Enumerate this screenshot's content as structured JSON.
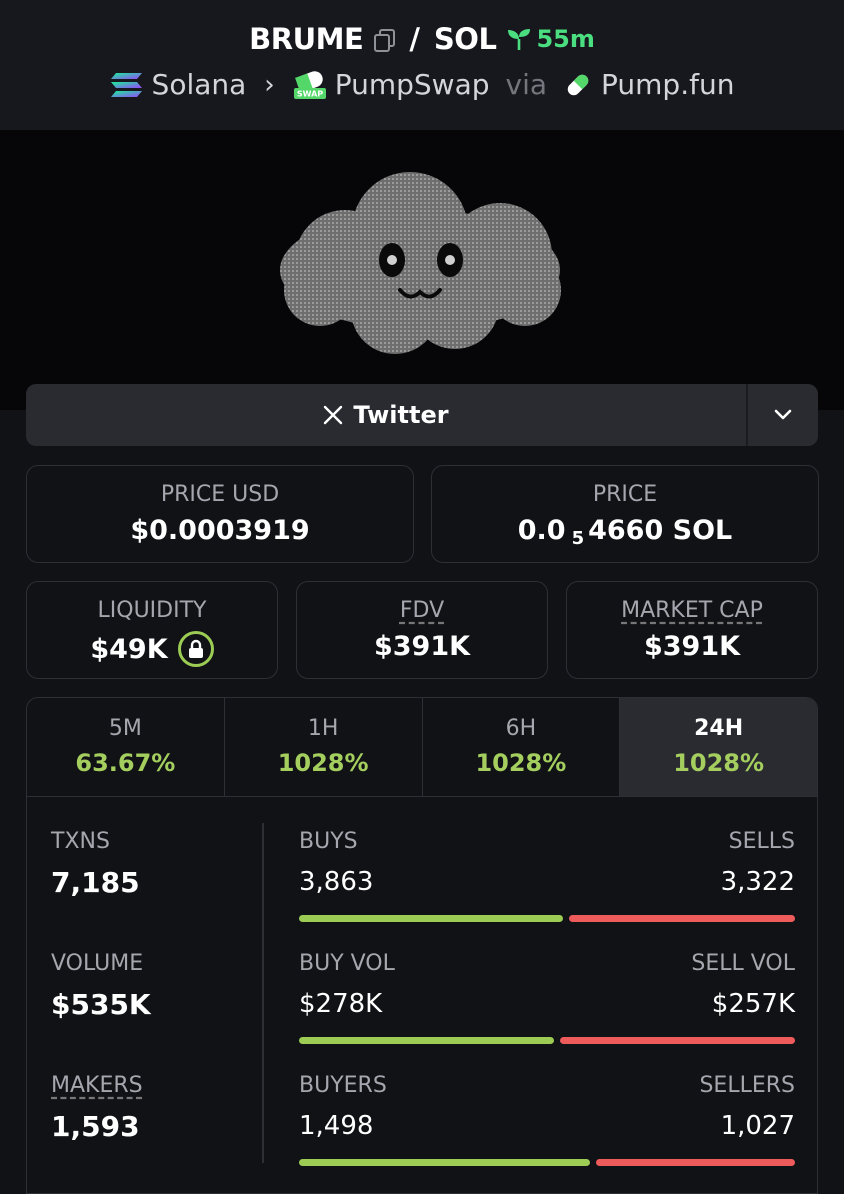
{
  "header": {
    "token": "BRUME",
    "separator": "/",
    "quote": "SOL",
    "age": "55m",
    "chain": "Solana",
    "dex": "PumpSwap",
    "via": "via",
    "launchpad": "Pump.fun",
    "dex_icon_text": "SWAP"
  },
  "socials": {
    "twitter_label": "Twitter"
  },
  "price": {
    "usd_label": "PRICE USD",
    "usd_value": "$0.0003919",
    "native_label": "PRICE",
    "native_prefix": "0.0",
    "native_zero_count": "5",
    "native_suffix": "4660 SOL"
  },
  "metrics": {
    "liquidity_label": "LIQUIDITY",
    "liquidity_value": "$49K",
    "fdv_label": "FDV",
    "fdv_value": "$391K",
    "mcap_label": "MARKET CAP",
    "mcap_value": "$391K"
  },
  "periods": [
    {
      "label": "5M",
      "value": "63.67%"
    },
    {
      "label": "1H",
      "value": "1028%"
    },
    {
      "label": "6H",
      "value": "1028%"
    },
    {
      "label": "24H",
      "value": "1028%"
    }
  ],
  "active_period": "24H",
  "stats": {
    "txns_label": "TXNS",
    "txns_value": "7,185",
    "volume_label": "VOLUME",
    "volume_value": "$535K",
    "makers_label": "MAKERS",
    "makers_value": "1,593",
    "buys_label": "BUYS",
    "buys_value": "3,863",
    "sells_label": "SELLS",
    "sells_value": "3,322",
    "buy_vol_label": "BUY VOL",
    "buy_vol_value": "$278K",
    "sell_vol_label": "SELL VOL",
    "sell_vol_value": "$257K",
    "buyers_label": "BUYERS",
    "buyers_value": "1,498",
    "sellers_label": "SELLERS",
    "sellers_value": "1,027",
    "buy_share_txns": 0.538,
    "buy_share_volume": 0.52,
    "buy_share_makers": 0.593
  },
  "colors": {
    "background": "#111216",
    "positive": "#a4cf5e",
    "buy_bar": "#9ccc54",
    "sell_bar": "#ee5b5b",
    "age_green": "#4ade80"
  }
}
